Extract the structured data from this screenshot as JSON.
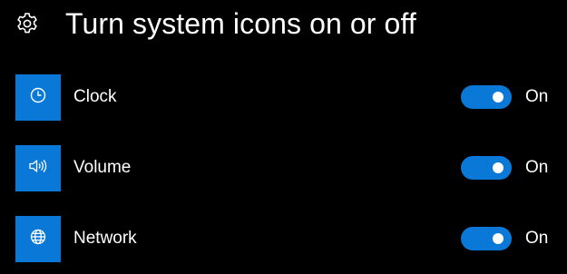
{
  "header": {
    "title": "Turn system icons on or off",
    "icon": "gear-icon"
  },
  "colors": {
    "accent": "#0a78d7",
    "background": "#000000",
    "text": "#ffffff"
  },
  "items": [
    {
      "label": "Clock",
      "icon": "clock-icon",
      "enabled": true,
      "state_label": "On"
    },
    {
      "label": "Volume",
      "icon": "volume-icon",
      "enabled": true,
      "state_label": "On"
    },
    {
      "label": "Network",
      "icon": "network-icon",
      "enabled": true,
      "state_label": "On"
    }
  ]
}
